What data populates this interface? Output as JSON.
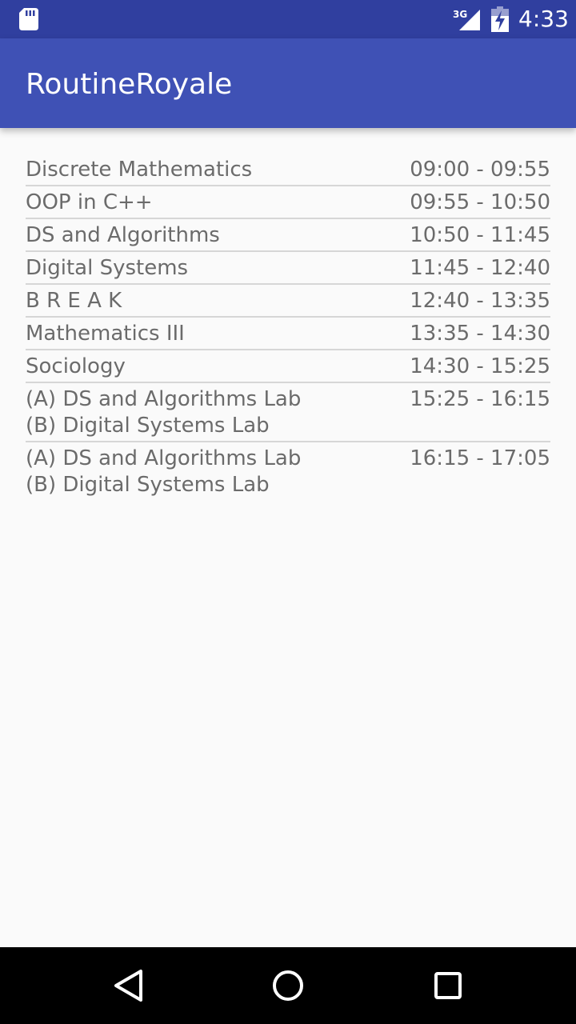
{
  "status_bar": {
    "network": "3G",
    "time": "4:33"
  },
  "app_bar": {
    "title": "RoutineRoyale"
  },
  "schedule": [
    {
      "subject": "Discrete Mathematics",
      "time": "09:00 - 09:55"
    },
    {
      "subject": "OOP in C++",
      "time": "09:55 - 10:50"
    },
    {
      "subject": "DS and Algorithms",
      "time": "10:50 - 11:45"
    },
    {
      "subject": "Digital Systems",
      "time": "11:45 - 12:40"
    },
    {
      "subject": "B R E A K",
      "time": "12:40 - 13:35"
    },
    {
      "subject": "Mathematics III",
      "time": "13:35 - 14:30"
    },
    {
      "subject": "Sociology",
      "time": "14:30 - 15:25"
    },
    {
      "subject": "(A) DS and Algorithms Lab\n(B) Digital Systems Lab",
      "time": "15:25 - 16:15"
    },
    {
      "subject": "(A) DS and Algorithms Lab\n(B) Digital Systems Lab",
      "time": "16:15 - 17:05"
    }
  ],
  "nav_bar": {
    "icons": [
      "back-icon",
      "home-icon",
      "recents-icon"
    ]
  },
  "colors": {
    "status_bar": "#303f9f",
    "app_bar": "#3f51b5",
    "background": "#fafafa",
    "text": "#6b6b6b",
    "divider": "#d6d6d6"
  }
}
